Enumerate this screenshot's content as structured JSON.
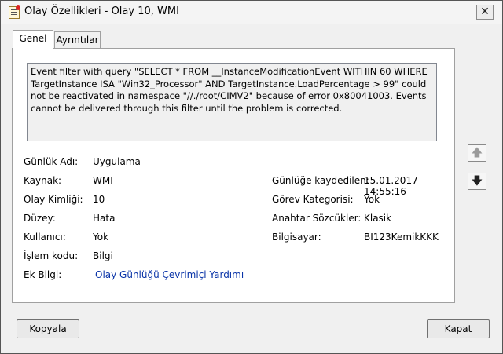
{
  "window": {
    "title": "Olay Özellikleri - Olay 10, WMI"
  },
  "tabs": [
    {
      "label": "Genel",
      "active": true
    },
    {
      "label": "Ayrıntılar",
      "active": false
    }
  ],
  "description": "Event filter with query \"SELECT * FROM __InstanceModificationEvent WITHIN 60 WHERE TargetInstance ISA \"Win32_Processor\" AND TargetInstance.LoadPercentage > 99\" could not be reactivated in namespace \"//./root/CIMV2\" because of error 0x80041003. Events cannot be delivered through this filter until the problem is corrected.",
  "fields": {
    "log_name_label": "Günlük Adı:",
    "log_name": "Uygulama",
    "source_label": "Kaynak:",
    "source": "WMI",
    "event_id_label": "Olay Kimliği:",
    "event_id": "10",
    "level_label": "Düzey:",
    "level": "Hata",
    "user_label": "Kullanıcı:",
    "user": "Yok",
    "opcode_label": "İşlem kodu:",
    "opcode": "Bilgi",
    "more_info_label": "Ek Bilgi:",
    "more_info_link": "Olay Günlüğü Çevrimiçi Yardımı",
    "logged_label": "Günlüğe kaydedilen:",
    "logged": "15.01.2017 14:55:16",
    "task_label": "Görev Kategorisi:",
    "task": "Yok",
    "keywords_label": "Anahtar Sözcükler:",
    "keywords": "Klasik",
    "computer_label": "Bilgisayar:",
    "computer": "BI123KemikKKK"
  },
  "buttons": {
    "copy": "Kopyala",
    "close": "Kapat"
  },
  "icons": {
    "close": "close-icon",
    "up": "arrow-up-icon",
    "down": "arrow-down-icon"
  }
}
